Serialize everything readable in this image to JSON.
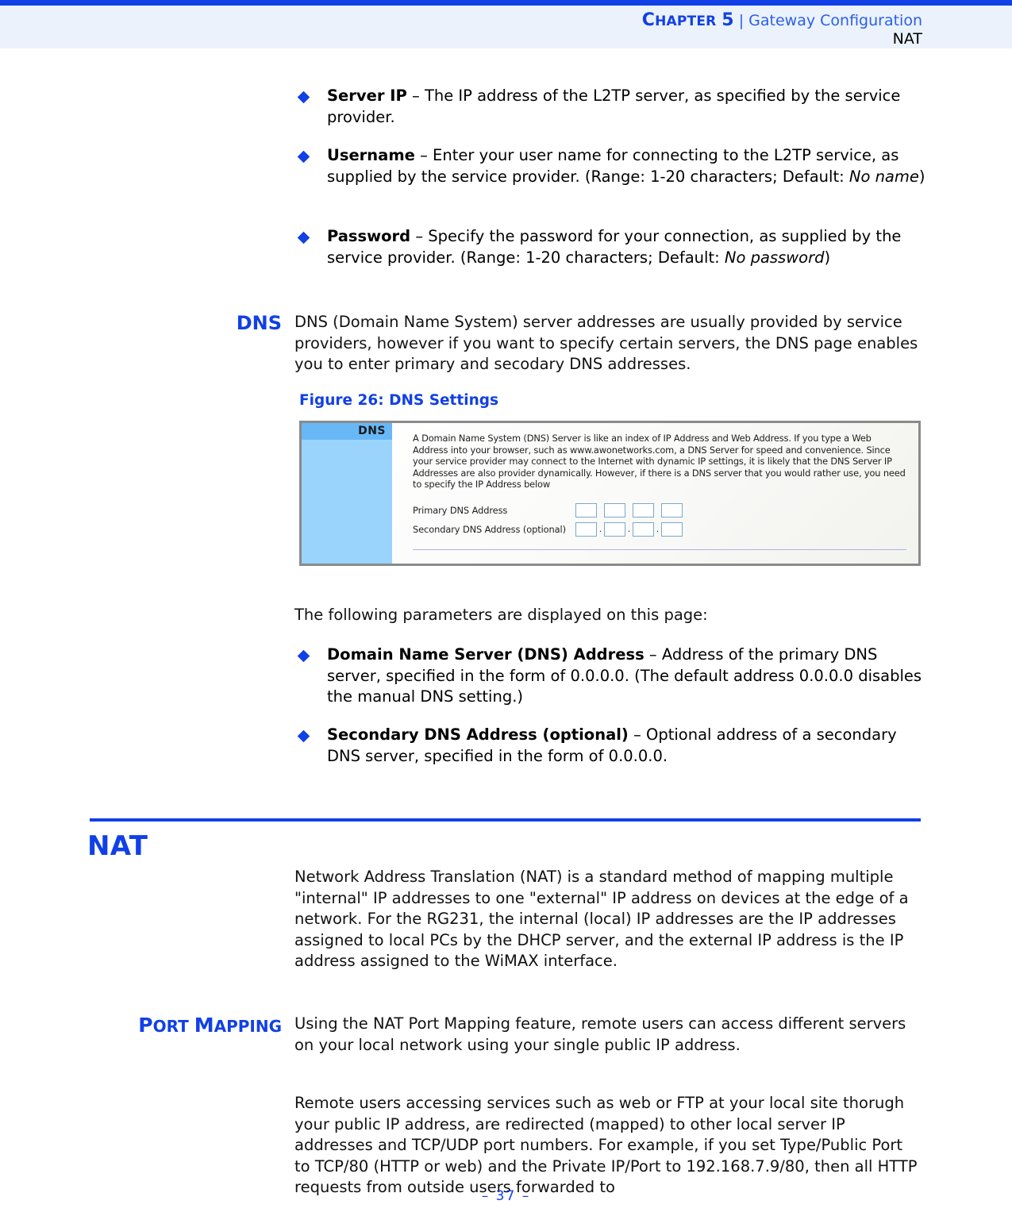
{
  "header": {
    "chapter_first": "C",
    "chapter_rest": "HAPTER",
    "chapter_number": "5",
    "separator": "|",
    "topic": "Gateway Configuration",
    "subtopic": "NAT"
  },
  "l2tp_bullets": [
    {
      "term": "Server IP",
      "dash": " – ",
      "text": "The IP address of the L2TP server, as specified by the service provider.",
      "italic_tail": "",
      "tail": ""
    },
    {
      "term": "Username",
      "dash": " – ",
      "text": "Enter your user name for connecting to the L2TP service, as supplied by the service provider. (Range: 1-20 characters; Default: ",
      "italic_tail": "No name",
      "tail": ")"
    },
    {
      "term": "Password",
      "dash": " – ",
      "text": "Specify the password for your connection, as supplied by the service provider. (Range: 1-20 characters; Default: ",
      "italic_tail": "No password",
      "tail": ")"
    }
  ],
  "dns_section": {
    "side_heading": "DNS",
    "intro": "DNS (Domain Name System) server addresses are usually provided by service providers, however if you want to specify certain servers, the DNS page enables you to enter primary and secodary DNS addresses.",
    "figure_caption": "Figure 26:  DNS Settings",
    "figure": {
      "nav_title": "DNS",
      "blurb": "A Domain Name System (DNS) Server is like an index of IP Address and Web Address. If you type a Web Address into your browser, such as www.awonetworks.com, a DNS Server for speed and convenience. Since your service provider may connect to the Internet with dynamic IP settings, it is likely that the DNS Server IP Addresses are also provider dynamically. However, if there is a DNS server that you would rather use, you need to specify the IP Address below",
      "fields": [
        {
          "label": "Primary DNS Address",
          "octets": 4,
          "dotted": false
        },
        {
          "label": "Secondary DNS Address (optional)",
          "octets": 4,
          "dotted": true
        }
      ],
      "dot": "."
    },
    "params_lead": "The following parameters are displayed on this page:",
    "param_bullets": [
      {
        "term": "Domain Name Server (DNS) Address",
        "dash": " – ",
        "text": "Address of the primary DNS server, specified in the form of 0.0.0.0. (The default address 0.0.0.0 disables the manual DNS setting.)"
      },
      {
        "term": "Secondary DNS Address (optional)",
        "dash": " – ",
        "text": "Optional address of a secondary DNS server, specified in the form of 0.0.0.0."
      }
    ]
  },
  "nat_section": {
    "title": "NAT",
    "intro": "Network Address Translation (NAT) is a standard method of mapping multiple \"internal\" IP addresses to one \"external\" IP address on devices at the edge of a network. For the RG231, the internal (local) IP addresses are the IP addresses assigned to local PCs by the DHCP server, and the external IP address is the IP address assigned to the WiMAX interface.",
    "port_mapping": {
      "side_heading_first": "P",
      "side_heading_rest": "ORT ",
      "side_heading_first2": "M",
      "side_heading_rest2": "APPING",
      "para1": "Using the NAT Port Mapping feature, remote users can access different servers on your local network using your single public IP address.",
      "para2": "Remote users accessing services such as web or FTP at your local site thorugh your public IP address, are redirected (mapped) to other local server IP addresses and TCP/UDP port numbers. For example, if you set Type/Public Port to TCP/80 (HTTP or web) and the Private IP/Port to 192.168.7.9/80, then all HTTP requests from outside users forwarded to"
    }
  },
  "footer": {
    "page": "–  37  –"
  },
  "colors": {
    "accent_blue": "#1140e6",
    "header_band": "#ebf2fb",
    "figure_nav": "#9ad4fd",
    "figure_nav_header": "#68b8f7"
  }
}
